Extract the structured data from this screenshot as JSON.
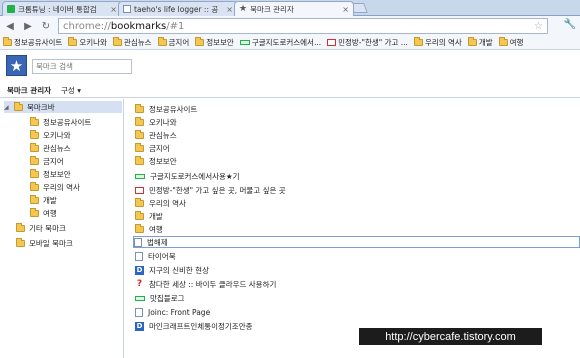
{
  "tabs": [
    {
      "title": "크롬튜닝 : 네이버 통합검",
      "icon": "green-icon"
    },
    {
      "title": "taeho's life logger :: 공",
      "icon": "doc-icon"
    },
    {
      "title": "북마크 관리자",
      "icon": "star-icon"
    }
  ],
  "omnibox": {
    "scheme": "chrome://",
    "host": "bookmarks",
    "rest": "/#1"
  },
  "bookmark_bar": [
    {
      "label": "정보공유사이트",
      "icon": "folder"
    },
    {
      "label": "오키나와",
      "icon": "folder"
    },
    {
      "label": "관심뉴스",
      "icon": "folder"
    },
    {
      "label": "금지어",
      "icon": "folder"
    },
    {
      "label": "정보보안",
      "icon": "folder"
    },
    {
      "label": "구글지도로커스에서...",
      "icon": "greenbar"
    },
    {
      "label": "민정방-\"한생\" 가고 ...",
      "icon": "gmail"
    },
    {
      "label": "우리의 역사",
      "icon": "folder"
    },
    {
      "label": "개발",
      "icon": "folder"
    },
    {
      "label": "여행",
      "icon": "folder"
    }
  ],
  "search": {
    "placeholder": "북마크 검색"
  },
  "subbar": {
    "title": "북마크 관리자",
    "organize": "구성 ▾"
  },
  "tree": [
    {
      "label": "북마크바",
      "level": 0,
      "expanded": true,
      "selected": true
    },
    {
      "label": "정보공유사이트",
      "level": 1
    },
    {
      "label": "오키나와",
      "level": 1
    },
    {
      "label": "관심뉴스",
      "level": 1
    },
    {
      "label": "금지어",
      "level": 1
    },
    {
      "label": "정보보안",
      "level": 1
    },
    {
      "label": "우리의 역사",
      "level": 1
    },
    {
      "label": "개발",
      "level": 1
    },
    {
      "label": "여행",
      "level": 1
    },
    {
      "label": "기타 북마크",
      "level": 0
    },
    {
      "label": "모바일 북마크",
      "level": 0
    }
  ],
  "list": [
    {
      "label": "정보공유사이트",
      "icon": "folder"
    },
    {
      "label": "오키나와",
      "icon": "folder"
    },
    {
      "label": "관심뉴스",
      "icon": "folder"
    },
    {
      "label": "금지어",
      "icon": "folder"
    },
    {
      "label": "정보보안",
      "icon": "folder"
    },
    {
      "label": "구글지도로커스에서사용★기",
      "icon": "greenbar"
    },
    {
      "label": "민정방-\"한생\" 가고 싶은 곳, 머물고 싶은 곳",
      "icon": "gmail"
    },
    {
      "label": "우리의 역사",
      "icon": "folder"
    },
    {
      "label": "개발",
      "icon": "folder"
    },
    {
      "label": "여행",
      "icon": "folder"
    },
    {
      "label": "법해제",
      "icon": "page",
      "selected": true
    },
    {
      "label": "타이어북",
      "icon": "page"
    },
    {
      "label": "지구의 신비한 현상",
      "icon": "d"
    },
    {
      "label": "참다한 세상 :: 바이두 클라우드 사용하기",
      "icon": "q"
    },
    {
      "label": "맛집블로그",
      "icon": "greenbar"
    },
    {
      "label": "Joinc: Front Page",
      "icon": "page"
    },
    {
      "label": "마인크래프트인체통이정기조안종",
      "icon": "d"
    }
  ],
  "watermark": "http://cybercafe.tistory.com"
}
